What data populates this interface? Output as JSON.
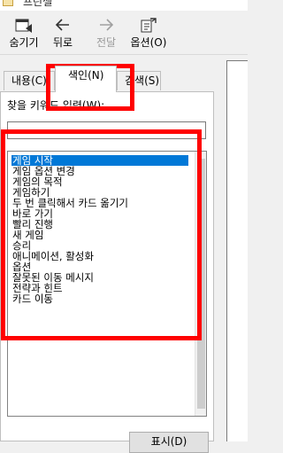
{
  "window": {
    "title": "프린셀"
  },
  "toolbar": {
    "hide_label": "숨기기",
    "back_label": "뒤로",
    "forward_label": "전달",
    "options_label": "옵션(O)"
  },
  "tabs": [
    {
      "label": "내용(C)"
    },
    {
      "label": "색인(N)"
    },
    {
      "label": "검색(S)"
    }
  ],
  "search": {
    "label": "찾을 키워드 입력(W):",
    "value": ""
  },
  "index_items": [
    "게임 시작",
    "게임 옵션 변경",
    "게임의 목적",
    "게임하기",
    "두 번 클릭해서 카드 옮기기",
    "바로 가기",
    "빨리 진행",
    "새 게임",
    "승리",
    "애니메이션, 활성화",
    "옵션",
    "잘못된 이동 메시지",
    "전략과 힌트",
    "카드 이동"
  ],
  "selected_index": 0,
  "display_button_label": "표시(D)",
  "colors": {
    "selection": "#0078d7",
    "annotation": "#ff0000"
  }
}
